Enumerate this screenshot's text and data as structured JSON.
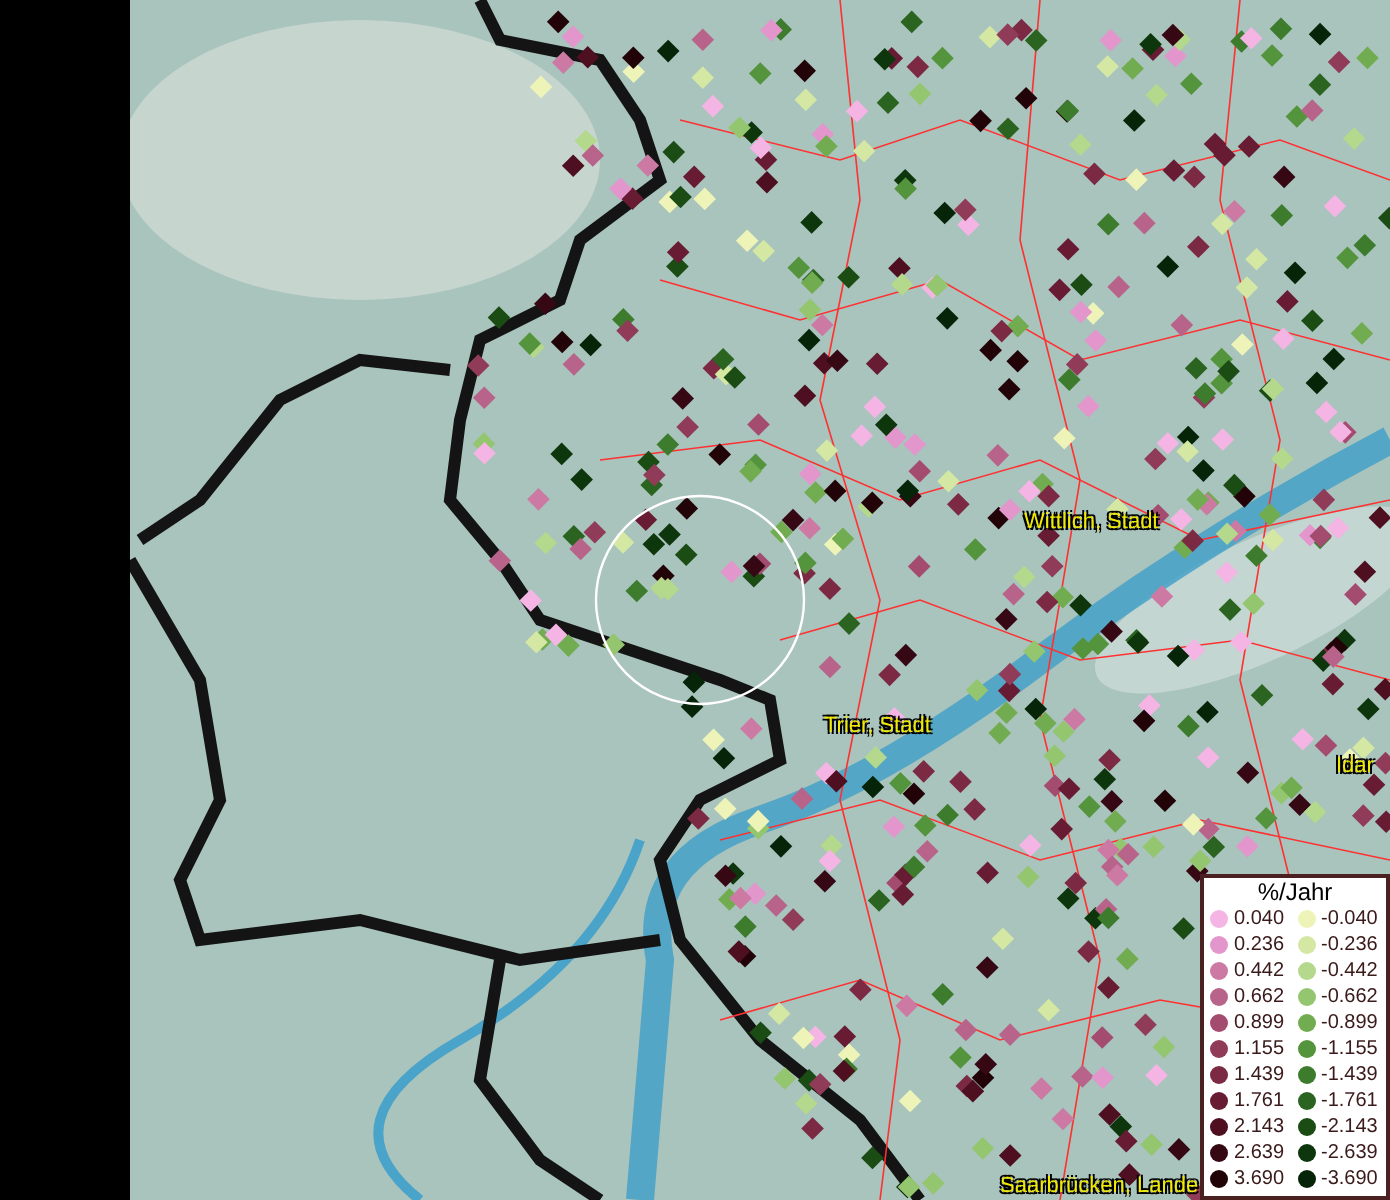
{
  "map": {
    "place_labels": [
      {
        "text": "Wittlich, Stadt"
      },
      {
        "text": "Trier, Stadt"
      },
      {
        "text": "Idar"
      },
      {
        "text": "Saarbrücken, Lande"
      }
    ]
  },
  "legend": {
    "title": "%/Jahr",
    "items": [
      {
        "label": "0.040",
        "color": "#f4b4e4"
      },
      {
        "label": "-0.040",
        "color": "#eef4b8"
      },
      {
        "label": "0.236",
        "color": "#e296cc"
      },
      {
        "label": "-0.236",
        "color": "#d4e8a4"
      },
      {
        "label": "0.442",
        "color": "#cc7aa4"
      },
      {
        "label": "-0.442",
        "color": "#b4d88c"
      },
      {
        "label": "0.662",
        "color": "#b8648a"
      },
      {
        "label": "-0.662",
        "color": "#94c670"
      },
      {
        "label": "0.899",
        "color": "#a44c70"
      },
      {
        "label": "-0.899",
        "color": "#72ac50"
      },
      {
        "label": "1.155",
        "color": "#903c58"
      },
      {
        "label": "-1.155",
        "color": "#54943c"
      },
      {
        "label": "1.439",
        "color": "#7c2a44"
      },
      {
        "label": "-1.439",
        "color": "#3c7c2c"
      },
      {
        "label": "1.761",
        "color": "#681c34"
      },
      {
        "label": "-1.761",
        "color": "#2a6420"
      },
      {
        "label": "2.143",
        "color": "#4e1020"
      },
      {
        "label": "-2.143",
        "color": "#1a4c14"
      },
      {
        "label": "2.639",
        "color": "#360814"
      },
      {
        "label": "-2.639",
        "color": "#0e360c"
      },
      {
        "label": "3.690",
        "color": "#220408"
      },
      {
        "label": "-3.690",
        "color": "#062408"
      }
    ]
  }
}
